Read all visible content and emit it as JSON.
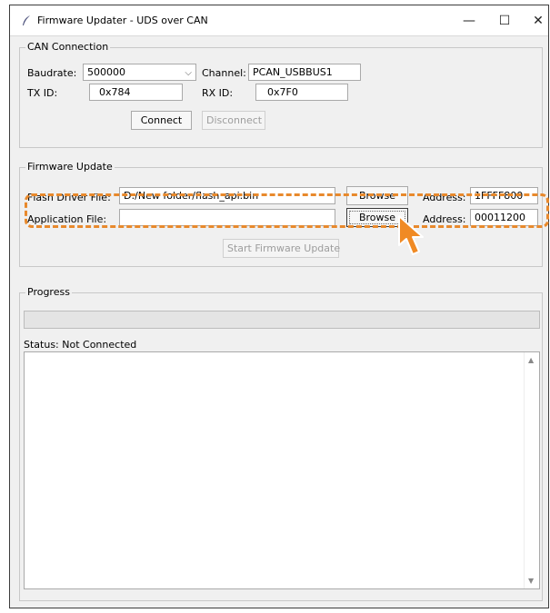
{
  "window": {
    "title": "Firmware Updater - UDS over CAN",
    "minimize_glyph": "—",
    "maximize_glyph": "☐",
    "close_glyph": "✕"
  },
  "can_connection": {
    "group_label": "CAN Connection",
    "baudrate_label": "Baudrate:",
    "baudrate_value": "500000",
    "channel_label": "Channel:",
    "channel_value": "PCAN_USBBUS1",
    "txid_label": "TX ID:",
    "txid_value": "0x784",
    "rxid_label": "RX ID:",
    "rxid_value": "0x7F0",
    "connect_label": "Connect",
    "disconnect_label": "Disconnect"
  },
  "firmware_update": {
    "group_label": "Firmware Update",
    "flash_driver_label": "Flash Driver File:",
    "flash_driver_value": "D:/New folder/flash_api.bin",
    "browse_label": "Browse",
    "address_label": "Address:",
    "flash_address_value": "1FFFF800",
    "app_file_label": "Application File:",
    "app_file_value": "",
    "app_address_value": "00011200",
    "start_label": "Start Firmware Update"
  },
  "progress": {
    "group_label": "Progress",
    "progress_value": 0,
    "status_text": "Status: Not Connected"
  },
  "colors": {
    "highlight": "#e8892c",
    "cursor": "#f08a24"
  }
}
